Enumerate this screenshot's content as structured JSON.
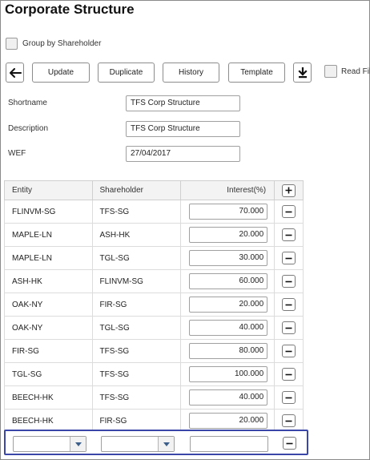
{
  "page": {
    "title": "Corporate Structure"
  },
  "options": {
    "group_by_label": "Group by Shareholder",
    "read_file_label": "Read File"
  },
  "toolbar": {
    "back_icon": "arrow-left-icon",
    "update_label": "Update",
    "duplicate_label": "Duplicate",
    "history_label": "History",
    "template_label": "Template",
    "download_icon": "download-icon"
  },
  "form": {
    "shortname_label": "Shortname",
    "shortname_value": "TFS Corp Structure",
    "description_label": "Description",
    "description_value": "TFS Corp Structure",
    "wef_label": "WEF",
    "wef_value": "27/04/2017"
  },
  "table": {
    "columns": {
      "entity": "Entity",
      "shareholder": "Shareholder",
      "interest": "Interest(%)"
    },
    "add_icon": "plus-icon",
    "remove_icon": "minus-icon",
    "rows": [
      {
        "entity": "FLINVM-SG",
        "shareholder": "TFS-SG",
        "interest": "70.000"
      },
      {
        "entity": "MAPLE-LN",
        "shareholder": "ASH-HK",
        "interest": "20.000"
      },
      {
        "entity": "MAPLE-LN",
        "shareholder": "TGL-SG",
        "interest": "30.000"
      },
      {
        "entity": "ASH-HK",
        "shareholder": "FLINVM-SG",
        "interest": "60.000"
      },
      {
        "entity": "OAK-NY",
        "shareholder": "FIR-SG",
        "interest": "20.000"
      },
      {
        "entity": "OAK-NY",
        "shareholder": "TGL-SG",
        "interest": "40.000"
      },
      {
        "entity": "FIR-SG",
        "shareholder": "TFS-SG",
        "interest": "80.000"
      },
      {
        "entity": "TGL-SG",
        "shareholder": "TFS-SG",
        "interest": "100.000"
      },
      {
        "entity": "BEECH-HK",
        "shareholder": "TFS-SG",
        "interest": "40.000"
      },
      {
        "entity": "BEECH-HK",
        "shareholder": "FIR-SG",
        "interest": "20.000"
      }
    ],
    "new_row": {
      "entity": "",
      "shareholder": "",
      "interest": ""
    }
  }
}
